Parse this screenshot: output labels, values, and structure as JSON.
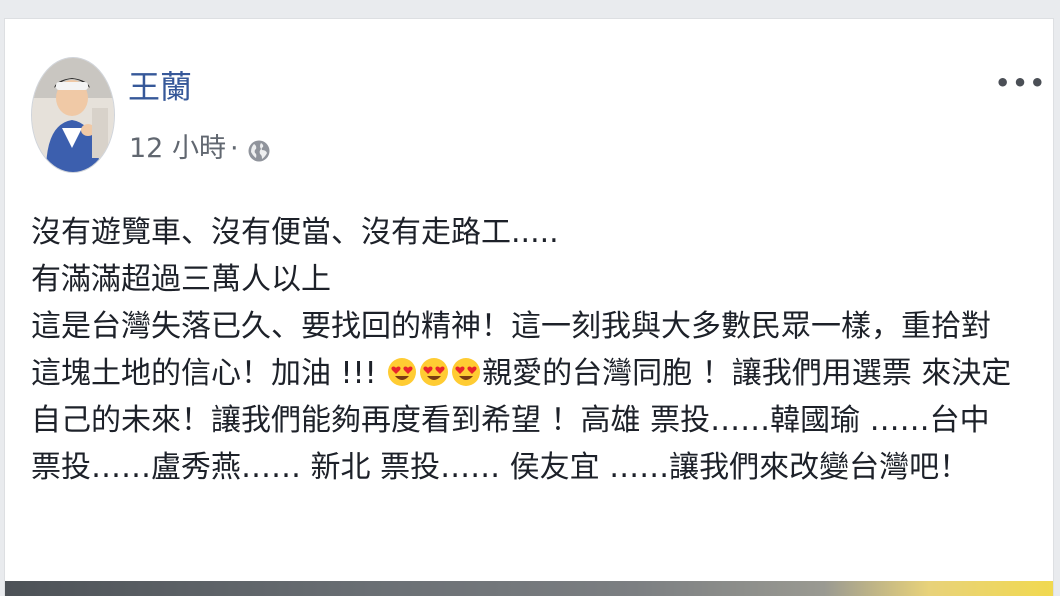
{
  "post": {
    "author": "王蘭",
    "time": "12 小時",
    "separator": "·",
    "privacy_icon": "globe-icon",
    "more_icon": "more-options-icon",
    "more_label": "•••",
    "lines": [
      {
        "text": "沒有遊覽車、沒有便當、沒有走路工....."
      },
      {
        "text": "有滿滿超過三萬人以上"
      },
      {
        "text": "這是台灣失落已久、要找回的精神！這一刻我與大多數民眾一樣，重拾對"
      },
      {
        "before": "這塊土地的信心！加油 !!! ",
        "emoji": "heart-eyes-emoji",
        "emoji_count": 3,
        "after": "親愛的台灣同胞 ！讓我們用選票 來決定"
      },
      {
        "text": "自己的未來！讓我們能夠再度看到希望 ！高雄 票投……韓國瑜 ……台中"
      },
      {
        "text": "票投……盧秀燕…… 新北 票投…… 侯友宜 ……讓我們來改變台灣吧！"
      }
    ]
  },
  "colors": {
    "author": "#365899",
    "meta": "#616770",
    "text": "#1d2129",
    "background": "#e9ebee",
    "card": "#ffffff"
  }
}
